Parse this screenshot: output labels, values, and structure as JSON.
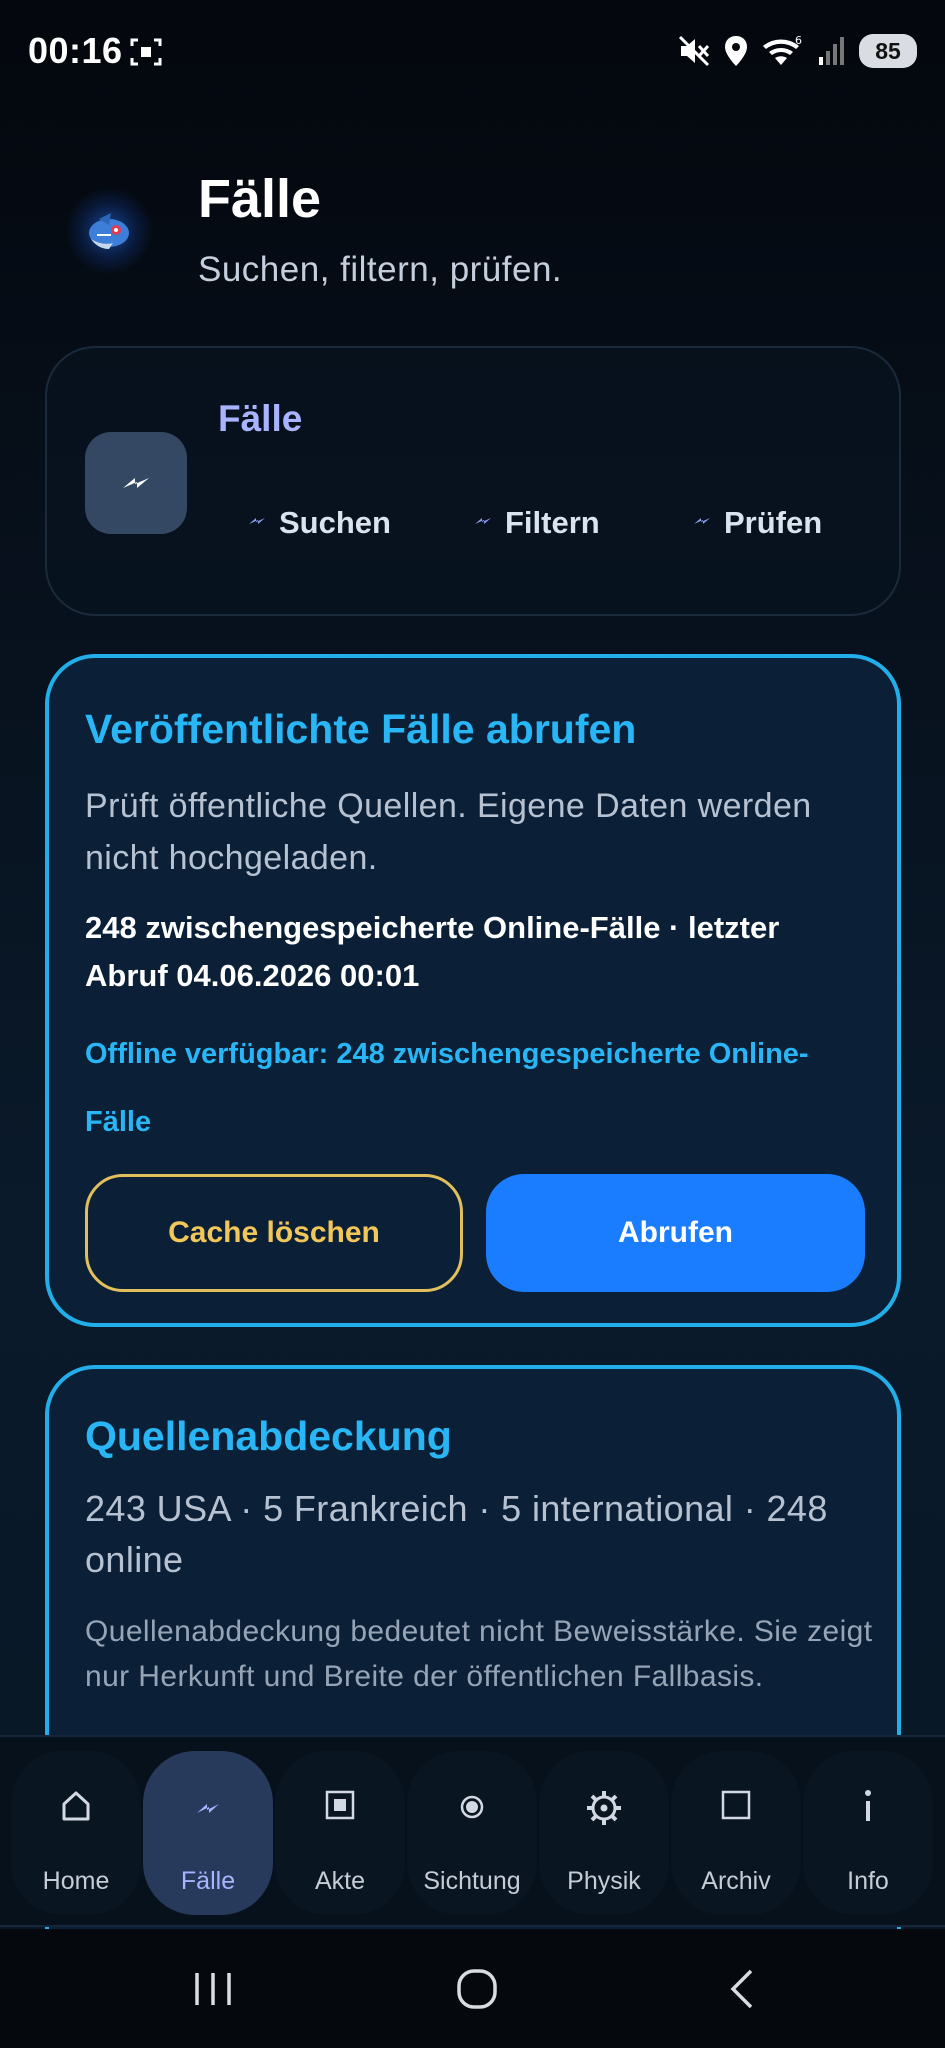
{
  "status_bar": {
    "time": "00:16",
    "battery": "85",
    "icons": [
      "screenshot-icon",
      "mute-icon",
      "location-icon",
      "wifi-icon",
      "signal-icon"
    ]
  },
  "header": {
    "logo_icon": "shark-logo",
    "title": "Fälle",
    "subtitle": "Suchen, filtern, prüfen."
  },
  "quick_card": {
    "title": "Fälle",
    "icon": "bolt-icon",
    "chips": [
      {
        "label": "Suchen"
      },
      {
        "label": "Filtern"
      },
      {
        "label": "Prüfen"
      }
    ]
  },
  "fetch_card": {
    "title": "Veröffentlichte Fälle abrufen",
    "description": "Prüft öffentliche Quellen. Eigene Daten werden nicht hochgeladen.",
    "status": "248 zwischengespeicherte Online-Fälle · letzter Abruf 04.06.2026 00:01",
    "offline": "Offline verfügbar: 248 zwischengespeicherte Online-Fälle",
    "cache_button": "Cache löschen",
    "fetch_button": "Abrufen"
  },
  "coverage_card": {
    "title": "Quellenabdeckung",
    "summary": "243 USA · 5 Frankreich · 5 international · 248 online",
    "note": "Quellenabdeckung bedeutet nicht Beweisstärke. Sie zeigt nur Herkunft und Breite der öffentlichen Fallbasis."
  },
  "bottom_nav": {
    "active": "Fälle",
    "items": [
      {
        "label": "Home",
        "icon": "home-icon"
      },
      {
        "label": "Fälle",
        "icon": "bolt-icon"
      },
      {
        "label": "Akte",
        "icon": "file-square-icon"
      },
      {
        "label": "Sichtung",
        "icon": "target-dot-icon"
      },
      {
        "label": "Physik",
        "icon": "gear-icon"
      },
      {
        "label": "Archiv",
        "icon": "square-icon"
      },
      {
        "label": "Info",
        "icon": "info-icon"
      }
    ]
  },
  "colors": {
    "accent": "#29b6f6",
    "primary_button": "#1a7dff",
    "warning_outline": "#e0bf5c",
    "nav_active": "#283a5c",
    "title_violet": "#a8b4ff"
  }
}
